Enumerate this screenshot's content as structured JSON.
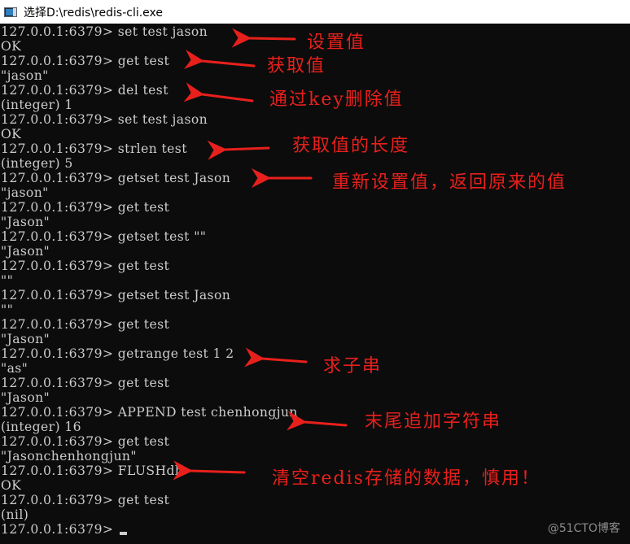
{
  "window": {
    "title": "选择D:\\redis\\redis-cli.exe",
    "icon": "console-window-icon"
  },
  "terminal": {
    "prompt": "127.0.0.1:6379> ",
    "lines": [
      "127.0.0.1:6379> set test jason",
      "OK",
      "127.0.0.1:6379> get test",
      "\"jason\"",
      "127.0.0.1:6379> del test",
      "(integer) 1",
      "127.0.0.1:6379> set test jason",
      "OK",
      "127.0.0.1:6379> strlen test",
      "(integer) 5",
      "127.0.0.1:6379> getset test Jason",
      "\"jason\"",
      "127.0.0.1:6379> get test",
      "\"Jason\"",
      "127.0.0.1:6379> getset test \"\"",
      "\"Jason\"",
      "127.0.0.1:6379> get test",
      "\"\"",
      "127.0.0.1:6379> getset test Jason",
      "\"\"",
      "127.0.0.1:6379> get test",
      "\"Jason\"",
      "127.0.0.1:6379> getrange test 1 2",
      "\"as\"",
      "127.0.0.1:6379> get test",
      "\"Jason\"",
      "127.0.0.1:6379> APPEND test chenhongjun",
      "(integer) 16",
      "127.0.0.1:6379> get test",
      "\"Jasonchenhongjun\"",
      "127.0.0.1:6379> FLUSHdb",
      "OK",
      "127.0.0.1:6379> get test",
      "(nil)",
      "127.0.0.1:6379> "
    ]
  },
  "annotations": {
    "color": "#e8201c",
    "items": [
      {
        "text": "设置值",
        "for_line": 0
      },
      {
        "text": "获取值",
        "for_line": 2
      },
      {
        "text": "通过key删除值",
        "for_line": 4
      },
      {
        "text": "获取值的长度",
        "for_line": 8
      },
      {
        "text": "重新设置值，返回原来的值",
        "for_line": 10
      },
      {
        "text": "求子串",
        "for_line": 22
      },
      {
        "text": "末尾追加字符串",
        "for_line": 26
      },
      {
        "text": "清空redis存储的数据，慎用！",
        "for_line": 30
      }
    ]
  },
  "watermark": "@51CTO博客"
}
